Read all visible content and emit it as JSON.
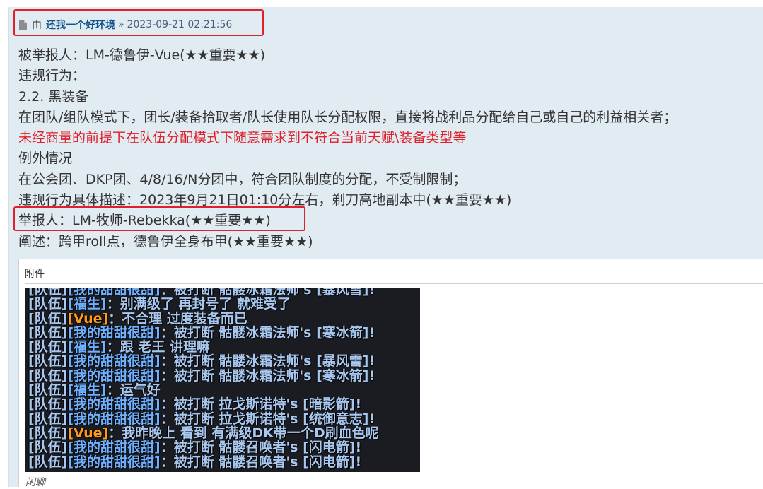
{
  "post": {
    "by_label": "由",
    "author": "还我一个好环境",
    "separator": "»",
    "datetime": "2023-09-21 02:21:56",
    "lines": [
      "被举报人：LM-德鲁伊-Vue(★★重要★★)",
      "违规行为：",
      "2.2. 黑装备",
      "在团队/组队模式下，团长/装备拾取者/队长使用队长分配权限，直接将战利品分配给自己或自己的利益相关者；",
      "未经商量的前提下在队伍分配模式下随意需求到不符合当前天赋\\装备类型等",
      "例外情况",
      "在公会团、DKP团、4/8/16/N分团中，符合团队制度的分配，不受制限制；",
      "违规行为具体描述：2023年9月21日01:10分左右，剃刀高地副本中(★★重要★★)",
      "举报人：LM-牧师-Rebekka(★★重要★★)",
      "阐述：跨甲roll点，德鲁伊全身布甲(★★重要★★)"
    ],
    "highlight_color": "#e0202a"
  },
  "attachment": {
    "title": "附件",
    "caption": "闲聊",
    "chat": [
      {
        "channel": "[队伍]",
        "speaker": "[我的甜甜很甜]",
        "speaker_type": "sp",
        "text": "：被打断 骷髅冰霜法师's [暴风雪]!"
      },
      {
        "channel": "[队伍]",
        "speaker": "[福生]",
        "speaker_type": "sp",
        "text": "：别满级了 再封号了 就难受了"
      },
      {
        "channel": "[队伍]",
        "speaker": "[Vue]",
        "speaker_type": "vue",
        "text": "：不合理 过度装备而已"
      },
      {
        "channel": "[队伍]",
        "speaker": "[我的甜甜很甜]",
        "speaker_type": "sp",
        "text": "：被打断 骷髅冰霜法师's [寒冰箭]!"
      },
      {
        "channel": "[队伍]",
        "speaker": "[福生]",
        "speaker_type": "sp",
        "text": "：跟 老王 讲理嘛"
      },
      {
        "channel": "[队伍]",
        "speaker": "[我的甜甜很甜]",
        "speaker_type": "sp",
        "text": "：被打断 骷髅冰霜法师's [暴风雪]!"
      },
      {
        "channel": "[队伍]",
        "speaker": "[我的甜甜很甜]",
        "speaker_type": "sp",
        "text": "：被打断 骷髅冰霜法师's [寒冰箭]!"
      },
      {
        "channel": "[队伍]",
        "speaker": "[福生]",
        "speaker_type": "sp",
        "text": "：运气好"
      },
      {
        "channel": "[队伍]",
        "speaker": "[我的甜甜很甜]",
        "speaker_type": "sp",
        "text": "：被打断 拉戈斯诺特's [暗影箭]!"
      },
      {
        "channel": "[队伍]",
        "speaker": "[我的甜甜很甜]",
        "speaker_type": "sp",
        "text": "：被打断 拉戈斯诺特's [统御意志]!"
      },
      {
        "channel": "[队伍]",
        "speaker": "[Vue]",
        "speaker_type": "vue",
        "text": "：我昨晚上 看到 有满级DK带一个D刷血色呢"
      },
      {
        "channel": "[队伍]",
        "speaker": "[我的甜甜很甜]",
        "speaker_type": "sp",
        "text": "：被打断 骷髅召唤者's [闪电箭]!"
      },
      {
        "channel": "[队伍]",
        "speaker": "[我的甜甜很甜]",
        "speaker_type": "sp",
        "text": "：被打断 骷髅召唤者's [闪电箭]!"
      }
    ]
  },
  "icons": {
    "post_icon": "document-icon"
  }
}
